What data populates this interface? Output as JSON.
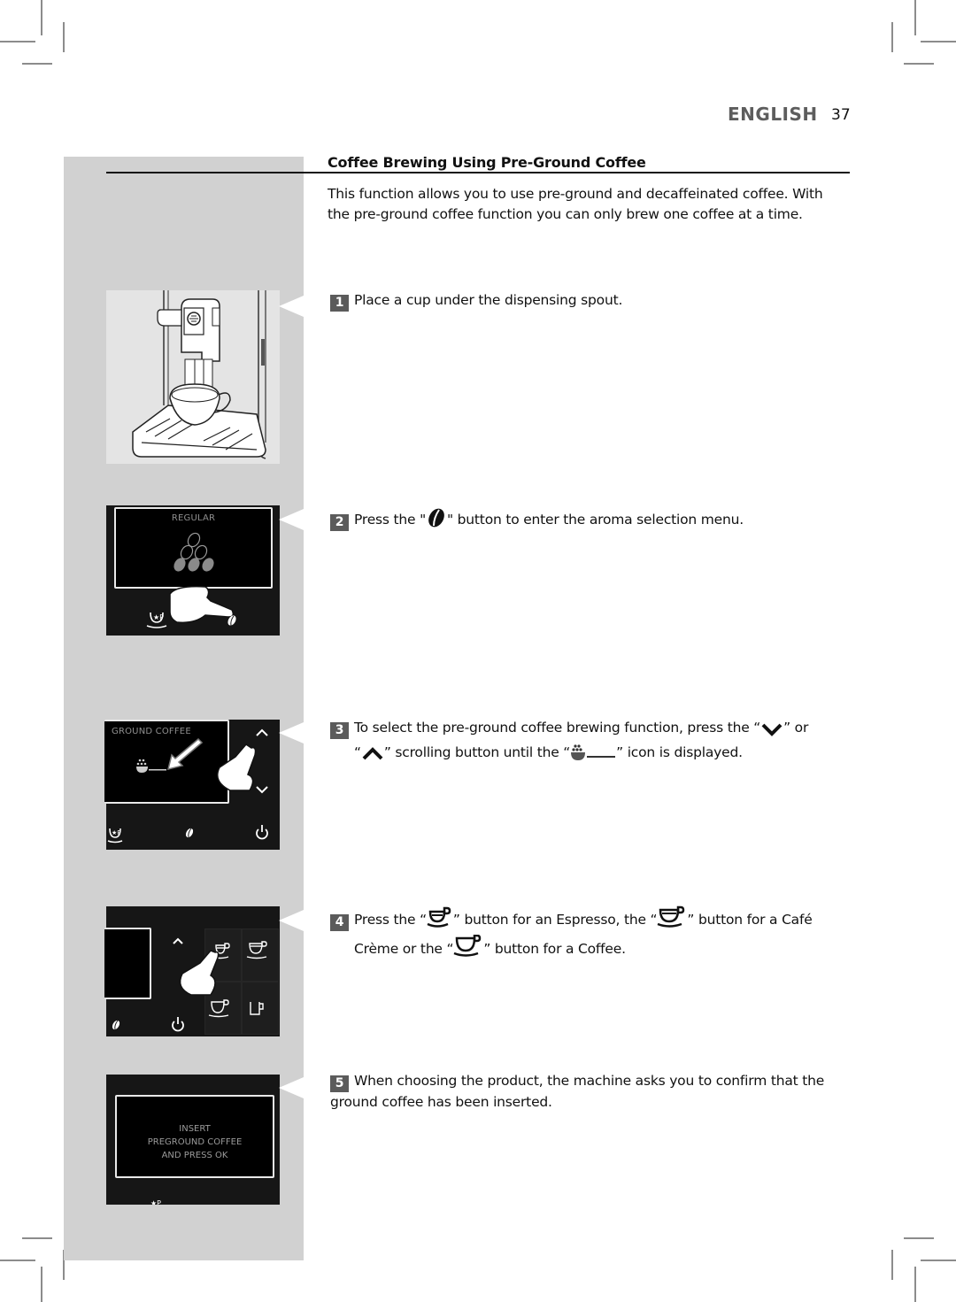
{
  "header": {
    "language": "ENGLISH",
    "page_number": "37"
  },
  "section": {
    "title": "Coffee Brewing Using Pre-Ground Coffee",
    "intro": "This function allows you to use pre-ground and decaffeinated coffee. With the pre-ground coffee function you can only brew one coffee at a time."
  },
  "steps": [
    {
      "number": "1",
      "text": "Place a cup under the dispensing spout."
    },
    {
      "number": "2",
      "text_before": "Press the \"",
      "icon": "coffee-bean-icon",
      "text_after": "\" button to enter the aroma selection menu."
    },
    {
      "number": "3",
      "text_part1": "To select the pre-ground coffee brewing function, press the “",
      "icon1": "chevron-down-icon",
      "text_part2": "” or",
      "text_part3": "“",
      "icon2": "chevron-up-icon",
      "text_part4": "” scrolling button until the “",
      "icon3": "ground-coffee-scoop-icon",
      "text_part5": "” icon is displayed."
    },
    {
      "number": "4",
      "text_part1": "Press the “",
      "icon1": "espresso-cup-icon",
      "text_part2": "” button for an Espresso, the “",
      "icon2": "cafe-creme-cup-icon",
      "text_part3": "” button for a Café",
      "text_part4": "Crème or the “",
      "icon3": "coffee-cup-icon",
      "text_part5": "” button for a Coffee."
    },
    {
      "number": "5",
      "text": "When choosing the product, the machine asks you to confirm that the ground coffee has been inserted."
    }
  ],
  "illustrations": {
    "machine": {
      "alt": "coffee-machine-cup-under-spout"
    },
    "aroma_panel": {
      "screen_label": "REGULAR"
    },
    "ground_panel": {
      "screen_label": "GROUND COFFEE"
    },
    "drinks_panel": {},
    "confirm_panel": {
      "lines": [
        "INSERT",
        "PREGROUND COFFEE",
        "AND PRESS OK"
      ]
    }
  },
  "colors": {
    "sidebar_gray": "#d1d1d1",
    "step_badge": "#5b5b5b",
    "panel_dark": "#161616",
    "header_lang": "#5d5d5d"
  }
}
